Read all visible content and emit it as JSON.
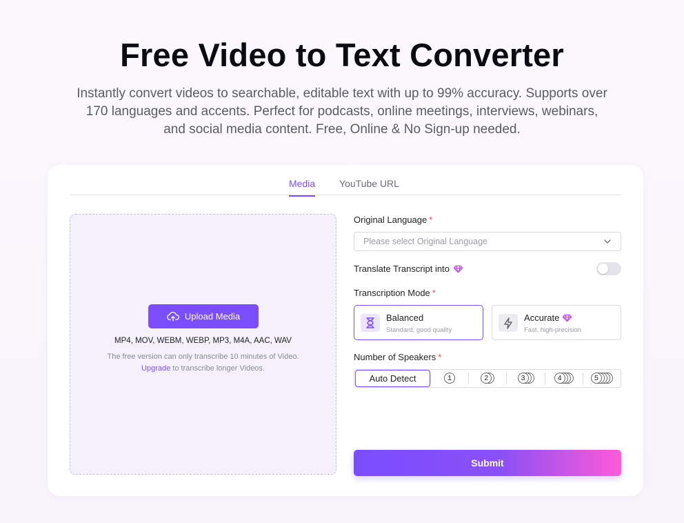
{
  "page": {
    "title": "Free Video to Text Converter",
    "subtitle": "Instantly convert videos to searchable, editable text with up to 99% accuracy. Supports over 170 languages and accents. Perfect for podcasts, online meetings, interviews, webinars, and social media content. Free, Online & No Sign-up needed."
  },
  "tabs": [
    {
      "label": "Media",
      "active": true
    },
    {
      "label": "YouTube URL",
      "active": false
    }
  ],
  "upload": {
    "button_label": "Upload Media",
    "formats": "MP4, MOV, WEBM, WEBP, MP3, M4A, AAC, WAV",
    "note": "The free version can only transcribe 10 minutes of Video.",
    "upgrade_link": "Upgrade",
    "upgrade_suffix": " to transcribe longer Videos."
  },
  "form": {
    "language_label": "Original Language",
    "language_placeholder": "Please select Original Language",
    "translate_label": "Translate Transcript into",
    "translate_enabled": false,
    "mode_label": "Transcription Mode",
    "modes": [
      {
        "title": "Balanced",
        "subtitle": "Standard, good quality",
        "selected": true,
        "icon": "hourglass-icon"
      },
      {
        "title": "Accurate",
        "subtitle": "Fast, high-precision",
        "selected": false,
        "icon": "lightning-icon",
        "premium": true
      }
    ],
    "speakers_label": "Number of Speakers",
    "speakers": {
      "auto_label": "Auto Detect",
      "options": [
        "1",
        "2",
        "3",
        "4",
        "5"
      ]
    },
    "required_mark": "*",
    "submit_label": "Submit"
  },
  "colors": {
    "accent": "#7a4dff",
    "gradient_end": "#ff5ad9",
    "required": "#e5484d"
  }
}
